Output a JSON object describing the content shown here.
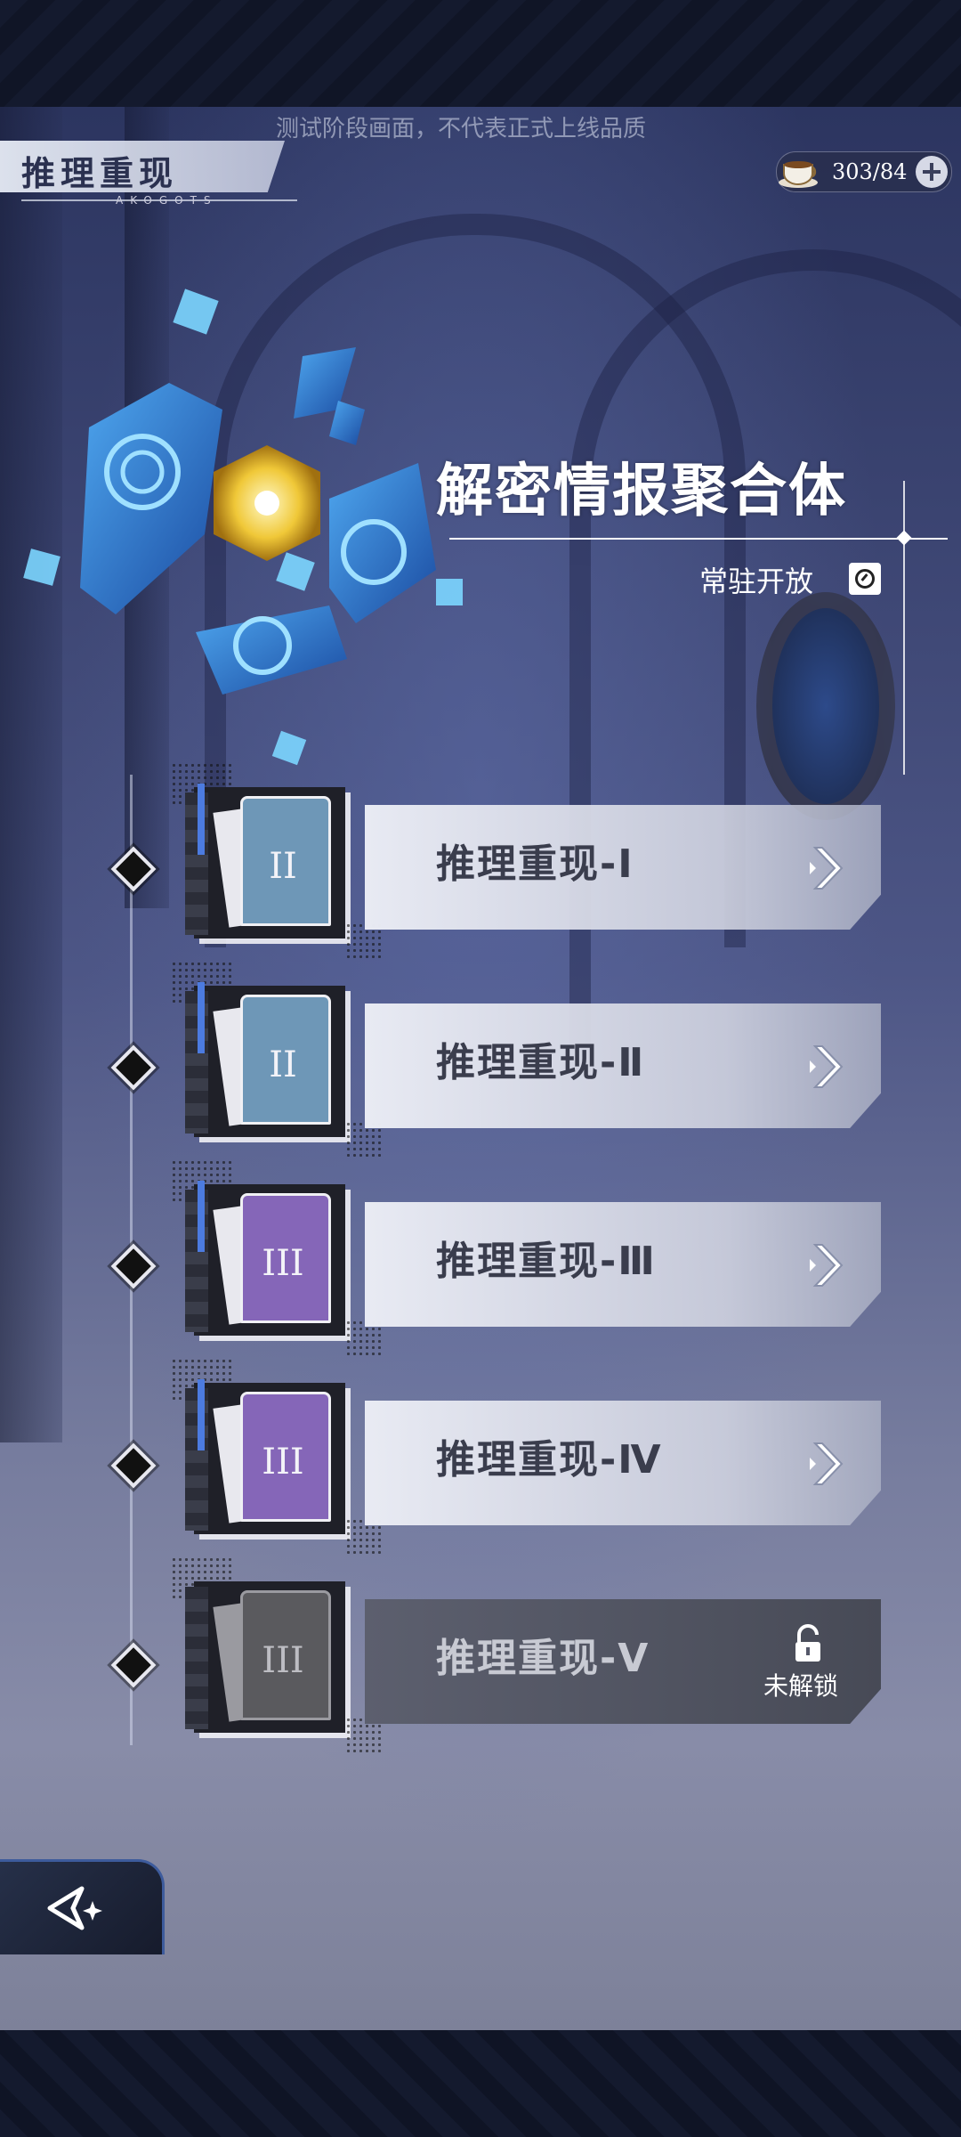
{
  "watermark": "测试阶段画面，不代表正式上线品质",
  "header": {
    "title": "推理重现",
    "title_sub": "AKOGOTS",
    "currency_value": "303/84"
  },
  "event": {
    "heading": "解密情报聚合体",
    "status": "常驻开放"
  },
  "levels": [
    {
      "label": "推理重现-Ⅰ",
      "numeral": "II",
      "locked": false,
      "color": "#6e97b7"
    },
    {
      "label": "推理重现-Ⅱ",
      "numeral": "II",
      "locked": false,
      "color": "#6e97b7"
    },
    {
      "label": "推理重现-Ⅲ",
      "numeral": "III",
      "locked": false,
      "color": "#8566b8"
    },
    {
      "label": "推理重现-Ⅳ",
      "numeral": "III",
      "locked": false,
      "color": "#8566b8"
    },
    {
      "label": "推理重现-Ⅴ",
      "numeral": "III",
      "locked": true,
      "color": "#5a5a5e",
      "lock_text": "未解锁"
    }
  ],
  "icons": [
    "cup-icon",
    "plus-icon",
    "clock-icon",
    "chevron-right-icon",
    "lock-icon",
    "back-arrow-icon"
  ]
}
